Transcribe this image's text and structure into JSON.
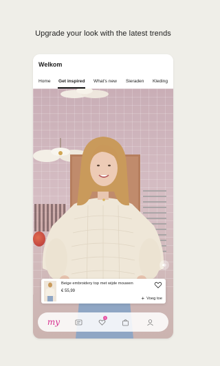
{
  "promo": {
    "text": "Upgrade your look with the latest trends"
  },
  "app": {
    "title": "Welkom"
  },
  "tabs": [
    {
      "label": "Home"
    },
    {
      "label": "Get inspired",
      "active": true
    },
    {
      "label": "What's new"
    },
    {
      "label": "Sieraden"
    },
    {
      "label": "Kleding"
    }
  ],
  "product": {
    "name": "Beige embroidery top met wijde mouwen",
    "price": "€ 55,99",
    "add_label": "Voeg toe"
  },
  "bottom_nav": {
    "logo": "my",
    "badge_count": "1",
    "items": [
      "home-logo",
      "feed-icon",
      "heart-icon",
      "bag-icon",
      "profile-icon"
    ]
  },
  "colors": {
    "background": "#efeee8",
    "brand": "#d62c8e",
    "badge": "#e74fa2"
  }
}
